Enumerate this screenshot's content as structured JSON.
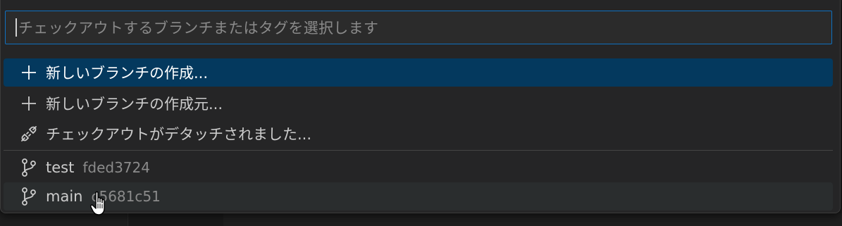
{
  "quick_pick": {
    "placeholder": "チェックアウトするブランチまたはタグを選択します",
    "actions": [
      {
        "label": "新しいブランチの作成...",
        "icon": "plus-icon"
      },
      {
        "label": "新しいブランチの作成元...",
        "icon": "plus-icon"
      },
      {
        "label": "チェックアウトがデタッチされました...",
        "icon": "debug-disconnect-icon"
      }
    ],
    "branches": [
      {
        "name": "test",
        "commit": "fded3724",
        "icon": "git-branch-icon"
      },
      {
        "name": "main",
        "commit": "c5681c51",
        "icon": "git-branch-icon"
      }
    ]
  },
  "colors": {
    "selection": "#04395e",
    "focus_border": "#0e70c0",
    "hover": "#2a2d2e"
  }
}
